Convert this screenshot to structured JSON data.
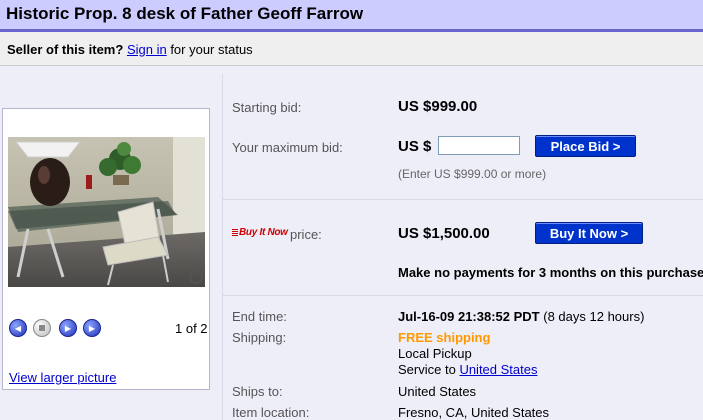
{
  "title": "Historic Prop. 8 desk of Father Geoff Farrow",
  "seller": {
    "prefix": "Seller of this item?",
    "sign_in": "Sign in",
    "suffix": "for your status"
  },
  "photo": {
    "pager": "1 of 2",
    "view_larger": "View larger picture"
  },
  "bid": {
    "starting_label": "Starting bid:",
    "starting_value": "US $999.00",
    "max_label": "Your maximum bid:",
    "currency_prefix": "US $",
    "input_value": "",
    "hint": "(Enter US $999.00 or more)",
    "place_bid_button": "Place Bid >"
  },
  "buy_it_now": {
    "logo_text": "Buy It Now",
    "price_label": "price:",
    "price_value": "US $1,500.00",
    "button": "Buy It Now >",
    "promo": "Make no payments for 3 months on this purchase"
  },
  "details": {
    "end_time_label": "End time:",
    "end_time_value": "Jul-16-09 21:38:52 PDT",
    "end_time_remaining": "(8 days 12 hours)",
    "shipping_label": "Shipping:",
    "shipping_free": "FREE shipping",
    "shipping_pickup": "Local Pickup",
    "shipping_service_prefix": "Service to",
    "shipping_service_link": "United States",
    "ships_to_label": "Ships to:",
    "ships_to_value": "United States",
    "location_label": "Item location:",
    "location_value": "Fresno, CA, United States"
  }
}
